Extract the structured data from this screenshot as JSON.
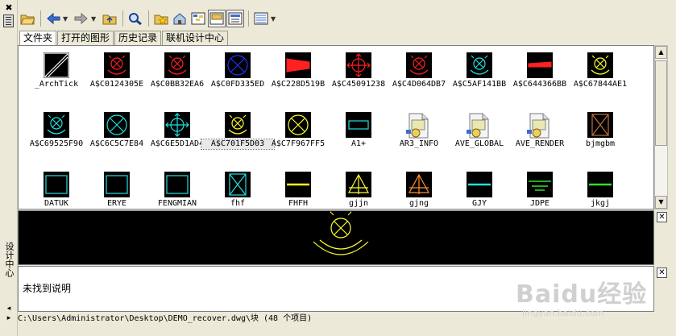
{
  "sidebar": {
    "close_glyph": "✖",
    "title": "设计中心",
    "arrow_up": "◂",
    "arrow_down": "▸"
  },
  "toolbar": {
    "buttons": [
      "load-icon",
      "back-icon",
      "forward-icon",
      "up-icon",
      "search-icon",
      "favorites-icon",
      "home-icon",
      "tree-view-toggle-icon",
      "preview-toggle-icon",
      "description-toggle-icon",
      "views-icon"
    ]
  },
  "tabs": [
    {
      "label": "文件夹",
      "active": true
    },
    {
      "label": "打开的图形",
      "active": false
    },
    {
      "label": "历史记录",
      "active": false
    },
    {
      "label": "联机设计中心",
      "active": false
    }
  ],
  "blocks": [
    {
      "name": "_ArchTick",
      "kind": "tick",
      "color": "#ffffff"
    },
    {
      "name": "A$C0124305E",
      "kind": "arrows-circle",
      "color": "#ff2020"
    },
    {
      "name": "A$C0BB32EA6",
      "kind": "arrows-circle",
      "color": "#ff2020"
    },
    {
      "name": "A$C0FD335ED",
      "kind": "circle-x",
      "color": "#2233ff"
    },
    {
      "name": "A$C228D519B",
      "kind": "wedge",
      "color": "#ff2020"
    },
    {
      "name": "A$C45091238",
      "kind": "cross-target",
      "color": "#ff2020"
    },
    {
      "name": "A$C4D064DB7",
      "kind": "arrows-circle",
      "color": "#ff2020"
    },
    {
      "name": "A$C5AF141BB",
      "kind": "arrows-circle",
      "color": "#20e0e0"
    },
    {
      "name": "A$C644366BB",
      "kind": "flat-wedge",
      "color": "#ff2020"
    },
    {
      "name": "A$C67844AE1",
      "kind": "arrows-circle",
      "color": "#ffff30"
    },
    {
      "name": "A$C69525F90",
      "kind": "arrows-circle",
      "color": "#20e0e0"
    },
    {
      "name": "A$C6C5C7E84",
      "kind": "circle-x",
      "color": "#20e0e0"
    },
    {
      "name": "A$C6E5D1AD4",
      "kind": "cross-target",
      "color": "#20e0e0"
    },
    {
      "name": "A$C701F5D03",
      "kind": "arrows-circle",
      "color": "#ffff30",
      "selected": true
    },
    {
      "name": "A$C7F967FF5",
      "kind": "circle-x",
      "color": "#ffff30"
    },
    {
      "name": "A1+",
      "kind": "rect-small",
      "color": "#20e0e0"
    },
    {
      "name": "AR3_INFO",
      "kind": "file",
      "color": "#ffffff"
    },
    {
      "name": "AVE_GLOBAL",
      "kind": "file",
      "color": "#ffffff"
    },
    {
      "name": "AVE_RENDER",
      "kind": "file",
      "color": "#ffffff"
    },
    {
      "name": "bjmgbm",
      "kind": "rect-x",
      "color": "#c07040"
    },
    {
      "name": "DATUK",
      "kind": "rect",
      "color": "#20e0e0"
    },
    {
      "name": "ERYE",
      "kind": "rect",
      "color": "#20e0e0"
    },
    {
      "name": "FENGMIAN",
      "kind": "rect",
      "color": "#20e0e0"
    },
    {
      "name": "fhf",
      "kind": "rect-x",
      "color": "#20e0e0"
    },
    {
      "name": "FHFH",
      "kind": "hline",
      "color": "#ffff30"
    },
    {
      "name": "gjjn",
      "kind": "triangle",
      "color": "#ffff30"
    },
    {
      "name": "gjng",
      "kind": "triangle",
      "color": "#ff9030"
    },
    {
      "name": "GJY",
      "kind": "hline",
      "color": "#20e0e0"
    },
    {
      "name": "JDPE",
      "kind": "hlines",
      "color": "#30e030"
    },
    {
      "name": "jkgj",
      "kind": "hline",
      "color": "#30e030"
    }
  ],
  "preview": {
    "color": "#ffff30"
  },
  "description": {
    "text": "未找到说明"
  },
  "status": {
    "path": "C:\\Users\\Administrator\\Desktop\\DEMO_recover.dwg\\块 (48 个项目)"
  },
  "watermark": {
    "brand": "Baidu经验",
    "url": "jingyan.baidu.com"
  }
}
